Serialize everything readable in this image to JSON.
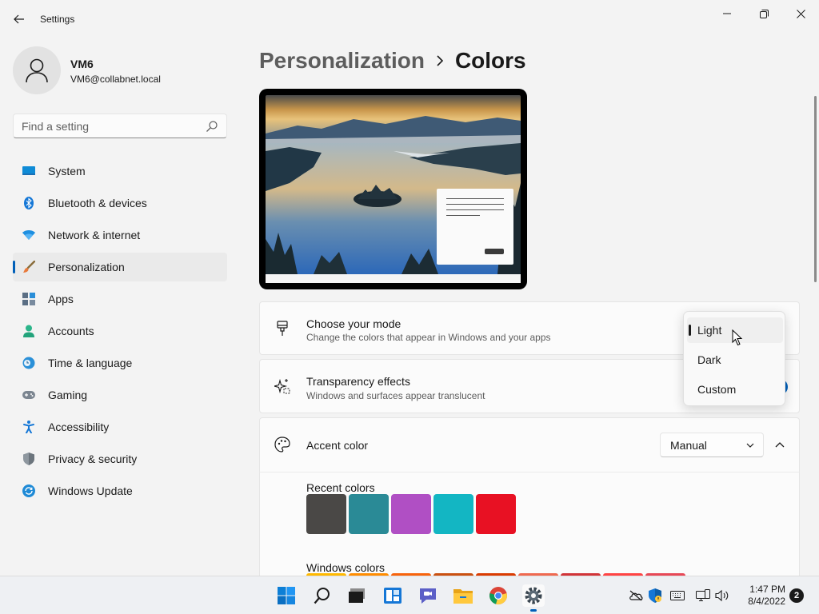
{
  "window": {
    "title": "Settings",
    "controls": [
      "minimize-icon",
      "restore-icon",
      "close-icon"
    ]
  },
  "profile": {
    "name": "VM6",
    "email": "VM6@collabnet.local"
  },
  "search": {
    "placeholder": "Find a setting"
  },
  "sidebar": {
    "items": [
      {
        "label": "System",
        "icon": "system-icon"
      },
      {
        "label": "Bluetooth & devices",
        "icon": "bluetooth-icon"
      },
      {
        "label": "Network & internet",
        "icon": "network-icon"
      },
      {
        "label": "Personalization",
        "icon": "personalization-icon",
        "selected": true
      },
      {
        "label": "Apps",
        "icon": "apps-icon"
      },
      {
        "label": "Accounts",
        "icon": "accounts-icon"
      },
      {
        "label": "Time & language",
        "icon": "time-language-icon"
      },
      {
        "label": "Gaming",
        "icon": "gaming-icon"
      },
      {
        "label": "Accessibility",
        "icon": "accessibility-icon"
      },
      {
        "label": "Privacy & security",
        "icon": "privacy-shield-icon"
      },
      {
        "label": "Windows Update",
        "icon": "windows-update-icon"
      }
    ]
  },
  "breadcrumb": {
    "parent": "Personalization",
    "current": "Colors"
  },
  "settings": {
    "mode": {
      "title": "Choose your mode",
      "subtitle": "Change the colors that appear in Windows and your apps",
      "icon": "brush-icon"
    },
    "transparency": {
      "title": "Transparency effects",
      "subtitle": "Windows and surfaces appear translucent",
      "icon": "sparkle-icon"
    },
    "accent": {
      "title": "Accent color",
      "icon": "palette-icon",
      "selected_value": "Manual",
      "recent_label": "Recent colors",
      "recent_colors": [
        "#4a4846",
        "#2a8a96",
        "#b04fc4",
        "#13b6c3",
        "#e81123"
      ],
      "windows_label": "Windows colors",
      "windows_colors": [
        "#ffb900",
        "#ff8c00",
        "#f7630c",
        "#ca5010",
        "#da3b01",
        "#ef6950",
        "#d13438",
        "#ff4343",
        "#e74856"
      ]
    }
  },
  "mode_popup": {
    "options": [
      "Light",
      "Dark",
      "Custom"
    ],
    "selected": "Light"
  },
  "taskbar": {
    "apps": [
      "start-icon",
      "search-icon",
      "task-view-icon",
      "widgets-icon",
      "teams-chat-icon",
      "file-explorer-icon",
      "chrome-icon",
      "settings-gear-icon"
    ],
    "tray": [
      "onedrive-offline-icon",
      "defender-shield-icon",
      "keyboard-icon",
      "network-display-icon",
      "volume-icon"
    ],
    "time": "1:47 PM",
    "date": "8/4/2022",
    "notifications": "2"
  },
  "colors": {
    "accent": "#005fb8",
    "background": "#f3f3f3",
    "card": "#fbfbfb"
  }
}
